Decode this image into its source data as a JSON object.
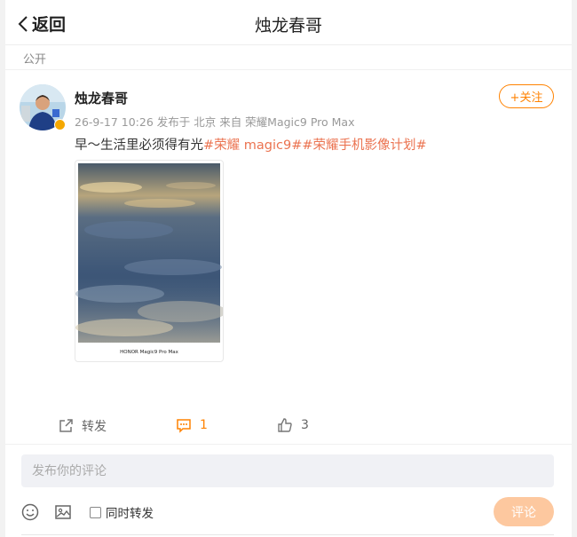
{
  "header": {
    "back_label": "返回",
    "title": "烛龙春哥"
  },
  "visibility": "公开",
  "post": {
    "author": "烛龙春哥",
    "meta": "26-9-17 10:26  发布于 北京  来自 荣耀Magic9 Pro Max",
    "follow_label": "+关注",
    "text": "早～生活里必须得有光",
    "tags": [
      "#荣耀 magic9#",
      "#荣耀手机影像计划#"
    ],
    "photo_caption": "HONOR Magic9 Pro Max"
  },
  "actions": {
    "repost_label": "转发",
    "comment_count": "1",
    "like_count": "3"
  },
  "compose": {
    "placeholder": "发布你的评论",
    "repost_checkbox_label": "同时转发",
    "submit_label": "评论"
  },
  "colors": {
    "accent": "#ff8200",
    "tag": "#eb7350",
    "submit_disabled": "#fdc89f"
  }
}
